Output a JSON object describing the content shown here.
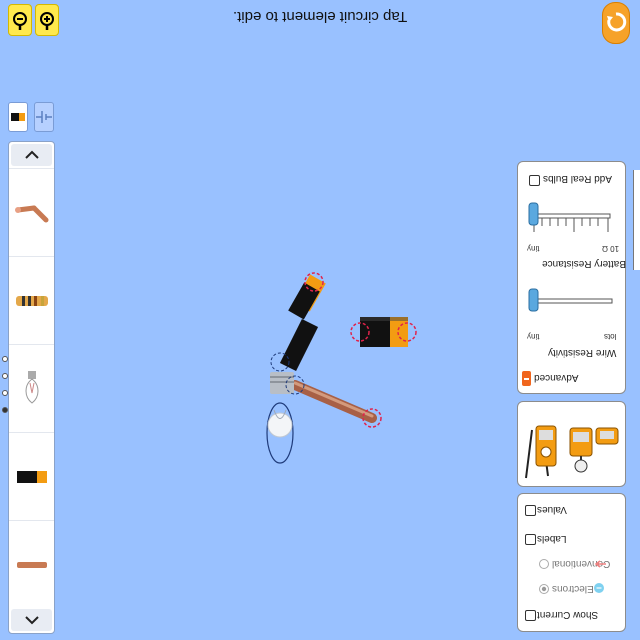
{
  "hint": "Tap circuit element to edit.",
  "icons": {
    "zoom_in": "zoom-in-icon",
    "zoom_out": "zoom-out-icon",
    "reset": "reset-icon"
  },
  "colors": {
    "background": "#99c1ff",
    "zoom_button": "#ffe94d",
    "reset_button": "#f6a229",
    "battery_orange": "#f39c12",
    "wire_copper": "#c87a53"
  },
  "toolbox": {
    "items": [
      "wire",
      "resistor",
      "light-bulb",
      "battery",
      "wire"
    ]
  },
  "advanced_panel": {
    "header": "Advanced",
    "wire_resistivity": {
      "label": "Wire Resistivity",
      "min": "tiny",
      "max": "lots"
    },
    "battery_resistance": {
      "label": "Battery Resistance",
      "min": "tiny",
      "max": "10 Ω"
    },
    "real_bulbs": "Add Real Bulbs"
  },
  "display_panel": {
    "show_current": "Show Current",
    "electrons": "Electrons",
    "conventional": "Conventional",
    "labels": "Labels",
    "values": "Values"
  }
}
